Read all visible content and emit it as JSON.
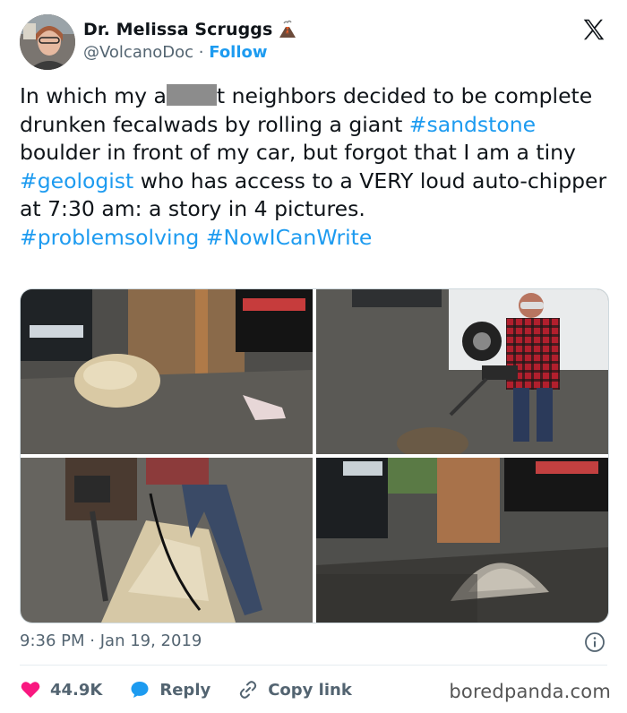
{
  "author": {
    "display_name": "Dr. Melissa Scruggs",
    "handle": "@VolcanoDoc",
    "separator": "·",
    "follow_label": "Follow",
    "badge_icon": "volcano-icon"
  },
  "tweet": {
    "segments": [
      {
        "text": "In which my a",
        "type": "text"
      },
      {
        "text": "t neighbors decided to be complete drunken fecalwads by rolling a giant ",
        "type": "text"
      },
      {
        "text": "#sandstone",
        "type": "hashtag"
      },
      {
        "text": " boulder in front of my car, but forgot that I am a tiny ",
        "type": "text"
      },
      {
        "text": "#geologist",
        "type": "hashtag"
      },
      {
        "text": " who has access to a VERY loud auto-chipper at 7:30 am: a story in 4 pictures.",
        "type": "text"
      },
      {
        "text": "#problemsolving",
        "type": "hashtag"
      },
      {
        "text": "#NowICanWrite",
        "type": "hashtag"
      }
    ]
  },
  "media": {
    "photos": [
      {
        "description": "boulder-in-driveway"
      },
      {
        "description": "woman-with-jackhammer"
      },
      {
        "description": "jackhammer-on-boulder"
      },
      {
        "description": "rubble-pile"
      }
    ]
  },
  "meta": {
    "time": "9:36 PM",
    "separator": "·",
    "date": "Jan 19, 2019"
  },
  "actions": {
    "like_count": "44.9K",
    "reply_label": "Reply",
    "copy_label": "Copy link"
  },
  "watermark": "boredpanda.com",
  "colors": {
    "accent": "#1d9bf0",
    "like": "#f91880",
    "text": "#0f1419",
    "muted": "#536471"
  }
}
